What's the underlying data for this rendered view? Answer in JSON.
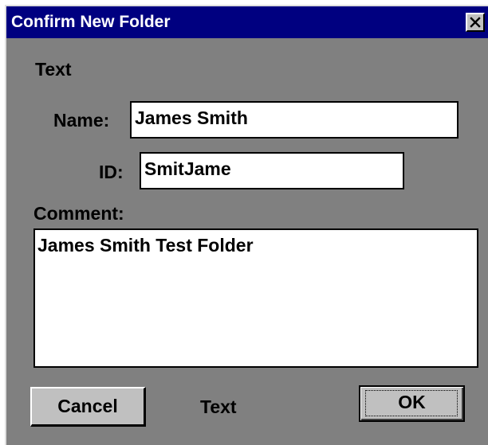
{
  "dialog": {
    "title": "Confirm New Folder",
    "close_icon": "close-x-icon",
    "top_text": "Text",
    "name_label": "Name:",
    "name_value": "James Smith",
    "id_label": "ID:",
    "id_value": "SmitJame",
    "comment_label": "Comment:",
    "comment_value": "James Smith Test Folder",
    "cancel_label": "Cancel",
    "bottom_text": "Text",
    "ok_label": "OK"
  },
  "colors": {
    "titlebar": "#000080",
    "dialog_background": "#808080",
    "button_face": "#c0c0c0",
    "field_background": "#ffffff"
  }
}
